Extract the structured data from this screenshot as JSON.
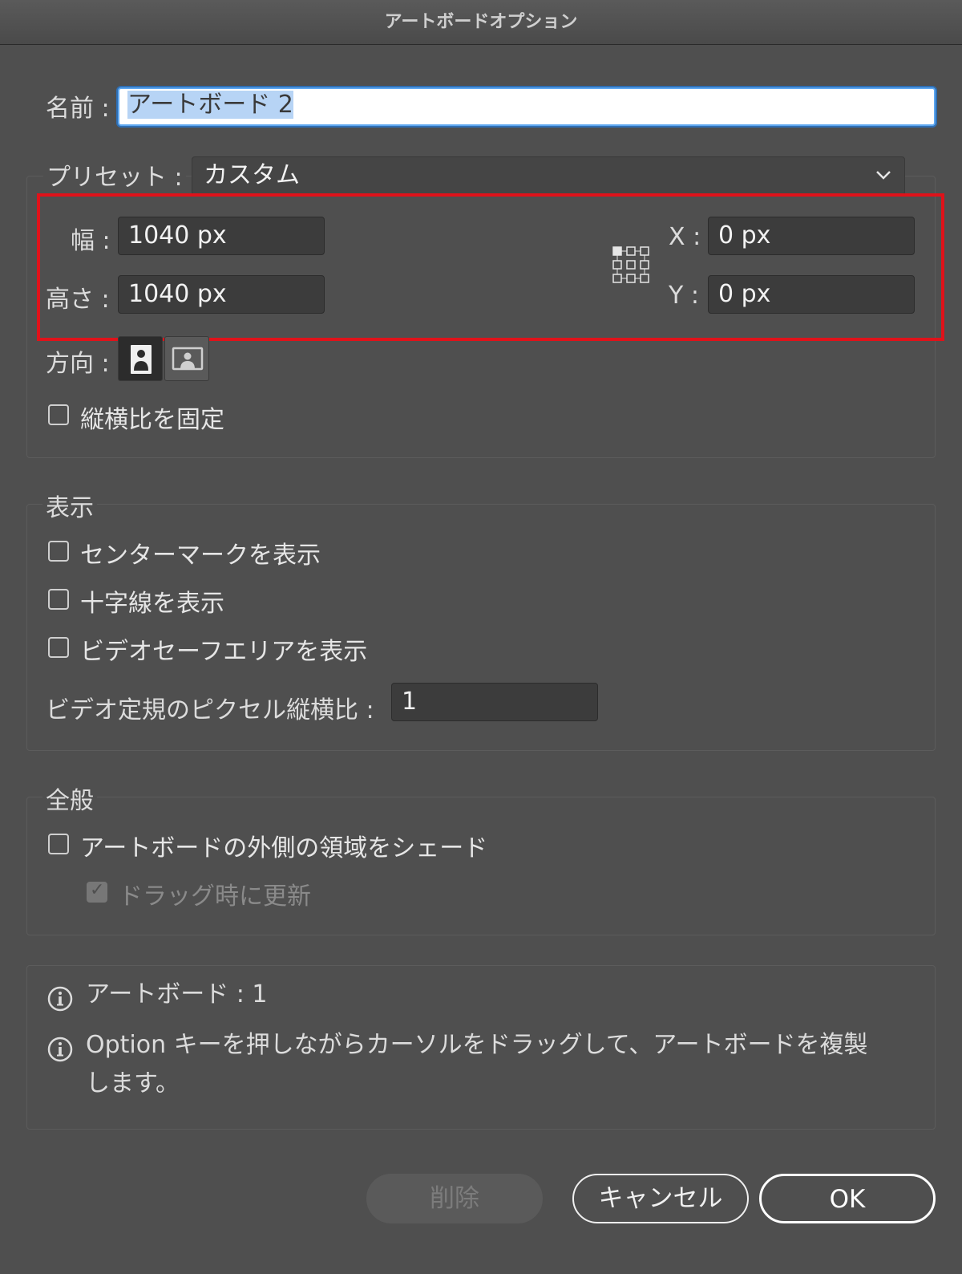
{
  "window": {
    "title": "アートボードオプション"
  },
  "name": {
    "label": "名前 :",
    "value": "アートボード 2"
  },
  "preset": {
    "label": "プリセット :",
    "value": "カスタム"
  },
  "size": {
    "width_label": "幅 :",
    "width_value": "1040 px",
    "height_label": "高さ :",
    "height_value": "1040 px",
    "x_label": "X :",
    "x_value": "0 px",
    "y_label": "Y :",
    "y_value": "0 px"
  },
  "orientation": {
    "label": "方向 :",
    "selected": "portrait"
  },
  "lock_ratio": {
    "label": "縦横比を固定",
    "checked": false
  },
  "display": {
    "legend": "表示",
    "center_mark": "センターマークを表示",
    "cross_hairs": "十字線を表示",
    "video_safe": "ビデオセーフエリアを表示",
    "pixel_ratio_label": "ビデオ定規のピクセル縦横比 :",
    "pixel_ratio_value": "1"
  },
  "general": {
    "legend": "全般",
    "shade_outside": "アートボードの外側の領域をシェード",
    "update_drag": "ドラッグ時に更新"
  },
  "info": {
    "count": "アートボード : 1",
    "hint": "Option キーを押しながらカーソルをドラッグして、アートボードを複製",
    "hint_cont": "します。"
  },
  "buttons": {
    "delete": "削除",
    "cancel": "キャンセル",
    "ok": "OK"
  },
  "colors": {
    "highlight": "#e0121a",
    "focus": "#5fa8f0"
  }
}
